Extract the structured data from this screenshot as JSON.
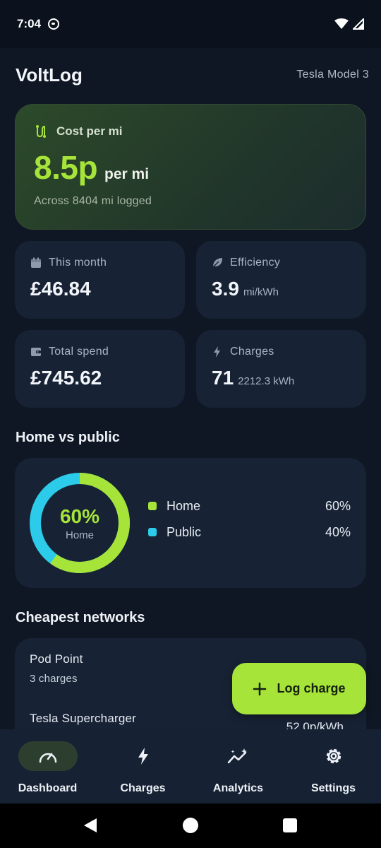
{
  "status_bar": {
    "time": "7:04"
  },
  "header": {
    "title": "VoltLog",
    "vehicle": "Tesla Model 3"
  },
  "hero": {
    "label": "Cost per mi",
    "value": "8.5p",
    "unit": "per mi",
    "subtext": "Across 8404 mi logged",
    "icon": "route-icon"
  },
  "stats": [
    {
      "label": "This month",
      "value": "£46.84",
      "unit": "",
      "icon": "calendar-icon"
    },
    {
      "label": "Efficiency",
      "value": "3.9",
      "unit": "mi/kWh",
      "icon": "leaf-icon"
    },
    {
      "label": "Total spend",
      "value": "£745.62",
      "unit": "",
      "icon": "wallet-icon"
    },
    {
      "label": "Charges",
      "value": "71",
      "unit": "2212.3 kWh",
      "icon": "bolt-icon"
    }
  ],
  "home_vs_public": {
    "title": "Home vs public",
    "center_value": "60%",
    "center_label": "Home",
    "legend": [
      {
        "name": "Home",
        "value": "60%",
        "color": "#a6e43a"
      },
      {
        "name": "Public",
        "value": "40%",
        "color": "#2ccbea"
      }
    ],
    "home_fraction": 0.6
  },
  "networks": {
    "title": "Cheapest networks",
    "items": [
      {
        "name": "Pod Point",
        "count": "3 charges",
        "rate": ""
      },
      {
        "name": "Tesla Supercharger",
        "count": "",
        "rate": "52.0p/kWh"
      }
    ]
  },
  "fab": {
    "label": "Log charge"
  },
  "bottom_nav": [
    {
      "label": "Dashboard",
      "icon": "speedometer-icon",
      "active": true
    },
    {
      "label": "Charges",
      "icon": "bolt-icon",
      "active": false
    },
    {
      "label": "Analytics",
      "icon": "analytics-icon",
      "active": false
    },
    {
      "label": "Settings",
      "icon": "gear-icon",
      "active": false
    }
  ],
  "colors": {
    "accent": "#a6e43a",
    "secondary": "#2ccbea",
    "background": "#0f1724",
    "card": "#172234"
  }
}
